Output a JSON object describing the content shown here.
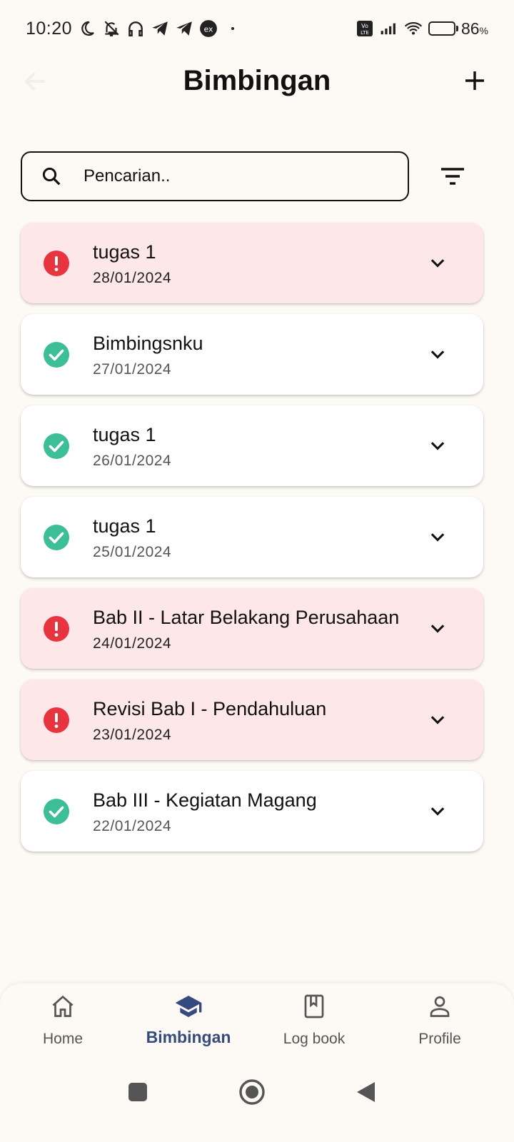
{
  "status_bar": {
    "time": "10:20",
    "battery_percent": "86",
    "battery_symbol": "%",
    "battery_level": 0.86,
    "network_label": "Vo LTE"
  },
  "header": {
    "title": "Bimbingan"
  },
  "search": {
    "placeholder": "Pencarian.."
  },
  "colors": {
    "pending_bg": "#fde7e9",
    "pending_icon": "#e8343f",
    "done_icon": "#3cbf94",
    "active_nav": "#354a7e"
  },
  "cards": [
    {
      "title": "tugas 1",
      "date": "28/01/2024",
      "status": "pending"
    },
    {
      "title": "Bimbingsnku",
      "date": "27/01/2024",
      "status": "done"
    },
    {
      "title": "tugas 1",
      "date": "26/01/2024",
      "status": "done"
    },
    {
      "title": "tugas 1",
      "date": "25/01/2024",
      "status": "done"
    },
    {
      "title": "Bab II - Latar Belakang Perusahaan",
      "date": "24/01/2024",
      "status": "pending"
    },
    {
      "title": "Revisi Bab I - Pendahuluan",
      "date": "23/01/2024",
      "status": "pending"
    },
    {
      "title": "Bab III - Kegiatan Magang",
      "date": "22/01/2024",
      "status": "done"
    }
  ],
  "bottom_nav": {
    "items": [
      {
        "label": "Home",
        "icon": "home-icon"
      },
      {
        "label": "Bimbingan",
        "icon": "graduation-cap-icon",
        "active": true
      },
      {
        "label": "Log book",
        "icon": "book-icon"
      },
      {
        "label": "Profile",
        "icon": "person-icon"
      }
    ]
  }
}
